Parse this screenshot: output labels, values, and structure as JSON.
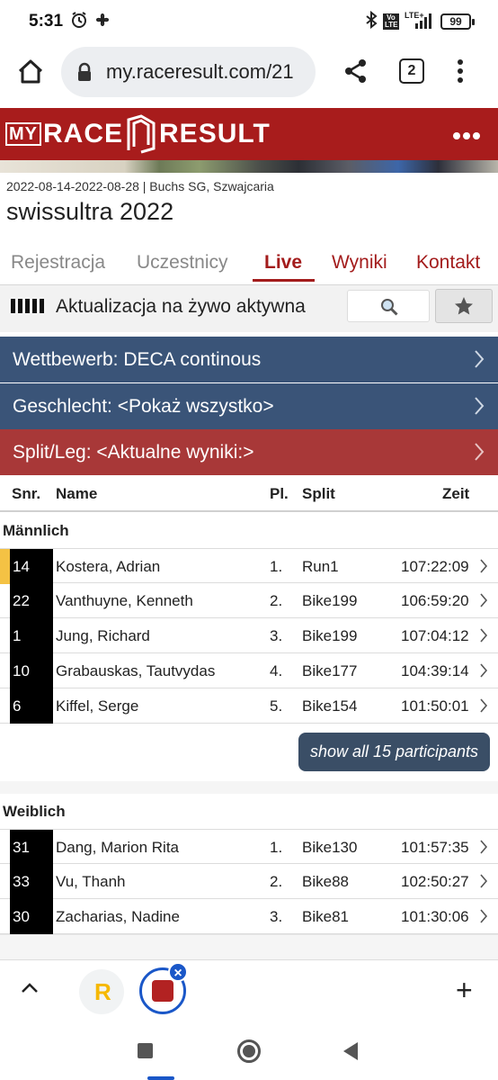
{
  "status_bar": {
    "time": "5:31",
    "network_label": "LTE+",
    "volte_label": "Vo LTE",
    "battery": "99"
  },
  "browser": {
    "url": "my.raceresult.com/21",
    "tab_count": "2"
  },
  "site": {
    "logo_my": "MY",
    "logo_race": "RACE",
    "logo_result": "RESULT"
  },
  "event": {
    "meta": "2022-08-14-2022-08-28 | Buchs SG, Szwajcaria",
    "title": "swissultra 2022"
  },
  "tabs": [
    {
      "label": "Rejestracja"
    },
    {
      "label": "Uczestnicy"
    },
    {
      "label": "Live"
    },
    {
      "label": "Wyniki"
    },
    {
      "label": "Kontakt"
    }
  ],
  "live": {
    "status_text": "Aktualizacja na żywo aktywna"
  },
  "filters": {
    "wettbewerb": "Wettbewerb: DECA continous",
    "geschlecht": "Geschlecht: <Pokaż wszystko>",
    "split": "Split/Leg: <Aktualne wyniki:>"
  },
  "table": {
    "headers": {
      "snr": "Snr.",
      "name": "Name",
      "pl": "Pl.",
      "split": "Split",
      "zeit": "Zeit"
    },
    "groups": [
      {
        "label": "Männlich",
        "rows": [
          {
            "snr": "14",
            "name": "Kostera, Adrian",
            "pl": "1.",
            "split": "Run1",
            "zeit": "107:22:09",
            "highlight": true
          },
          {
            "snr": "22",
            "name": "Vanthuyne, Kenneth",
            "pl": "2.",
            "split": "Bike199",
            "zeit": "106:59:20"
          },
          {
            "snr": "1",
            "name": "Jung, Richard",
            "pl": "3.",
            "split": "Bike199",
            "zeit": "107:04:12"
          },
          {
            "snr": "10",
            "name": "Grabauskas, Tautvydas",
            "pl": "4.",
            "split": "Bike177",
            "zeit": "104:39:14"
          },
          {
            "snr": "6",
            "name": "Kiffel, Serge",
            "pl": "5.",
            "split": "Bike154",
            "zeit": "101:50:01"
          }
        ],
        "show_all": "show all 15 participants"
      },
      {
        "label": "Weiblich",
        "rows": [
          {
            "snr": "31",
            "name": "Dang, Marion Rita",
            "pl": "1.",
            "split": "Bike130",
            "zeit": "101:57:35"
          },
          {
            "snr": "33",
            "name": "Vu, Thanh",
            "pl": "2.",
            "split": "Bike88",
            "zeit": "102:50:27"
          },
          {
            "snr": "30",
            "name": "Zacharias, Nadine",
            "pl": "3.",
            "split": "Bike81",
            "zeit": "101:30:06"
          }
        ]
      }
    ]
  },
  "bottom_tabs": {
    "tab1_letter": "R",
    "close_glyph": "×",
    "plus_glyph": "+"
  },
  "colors": {
    "brand_red": "#a81c1c",
    "filter_blue": "#3a5478",
    "filter_red": "#a83838",
    "leader_marker": "#f4c244"
  }
}
